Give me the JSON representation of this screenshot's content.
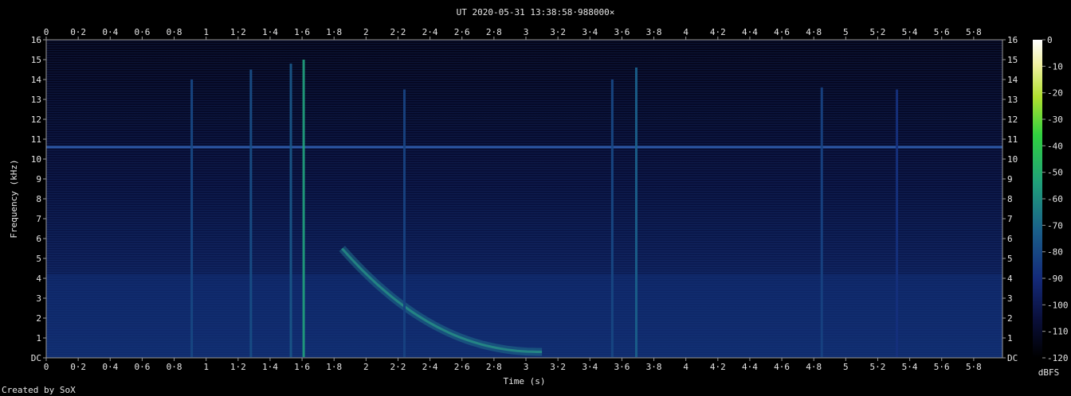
{
  "chart_data": {
    "type": "heatmap",
    "title": "UT 2020-05-31 13:38:58·988000×",
    "xlabel": "Time (s)",
    "ylabel": "Frequency (kHz)",
    "xlim": [
      0,
      5.98
    ],
    "ylim": [
      0,
      16
    ],
    "x_ticks": [
      "0",
      "0·2",
      "0·4",
      "0·6",
      "0·8",
      "1",
      "1·2",
      "1·4",
      "1·6",
      "1·8",
      "2",
      "2·2",
      "2·4",
      "2·6",
      "2·8",
      "3",
      "3·2",
      "3·4",
      "3·6",
      "3·8",
      "4",
      "4·2",
      "4·4",
      "4·6",
      "4·8",
      "5",
      "5·2",
      "5·4",
      "5·6",
      "5·8"
    ],
    "y_ticks": [
      "DC",
      "1",
      "2",
      "3",
      "4",
      "5",
      "6",
      "7",
      "8",
      "9",
      "10",
      "11",
      "12",
      "13",
      "14",
      "15",
      "16"
    ],
    "colorbar": {
      "label": "dBFS",
      "ticks": [
        "0",
        "-10",
        "-20",
        "-30",
        "-40",
        "-50",
        "-60",
        "-70",
        "-80",
        "-90",
        "-100",
        "-110",
        "-120"
      ],
      "range": [
        -120,
        0
      ]
    },
    "features": {
      "tone_line_khz": 10.6,
      "broadband_band_khz": [
        0,
        4.2
      ],
      "impulses": [
        {
          "t": 0.91,
          "f_max": 14.0,
          "level_dbfs": -80
        },
        {
          "t": 1.28,
          "f_max": 14.5,
          "level_dbfs": -78
        },
        {
          "t": 1.53,
          "f_max": 14.8,
          "level_dbfs": -75
        },
        {
          "t": 1.61,
          "f_max": 15.0,
          "level_dbfs": -55
        },
        {
          "t": 2.24,
          "f_max": 13.5,
          "level_dbfs": -82
        },
        {
          "t": 3.54,
          "f_max": 14.0,
          "level_dbfs": -80
        },
        {
          "t": 3.69,
          "f_max": 14.6,
          "level_dbfs": -72
        },
        {
          "t": 4.85,
          "f_max": 13.6,
          "level_dbfs": -82
        },
        {
          "t": 5.32,
          "f_max": 13.5,
          "level_dbfs": -88
        }
      ],
      "whistler": {
        "t_start": 1.85,
        "t_end": 3.1,
        "f_start_khz": 5.5,
        "f_end_khz": 0.3
      }
    }
  },
  "footer": {
    "credit": "Created by SoX"
  }
}
